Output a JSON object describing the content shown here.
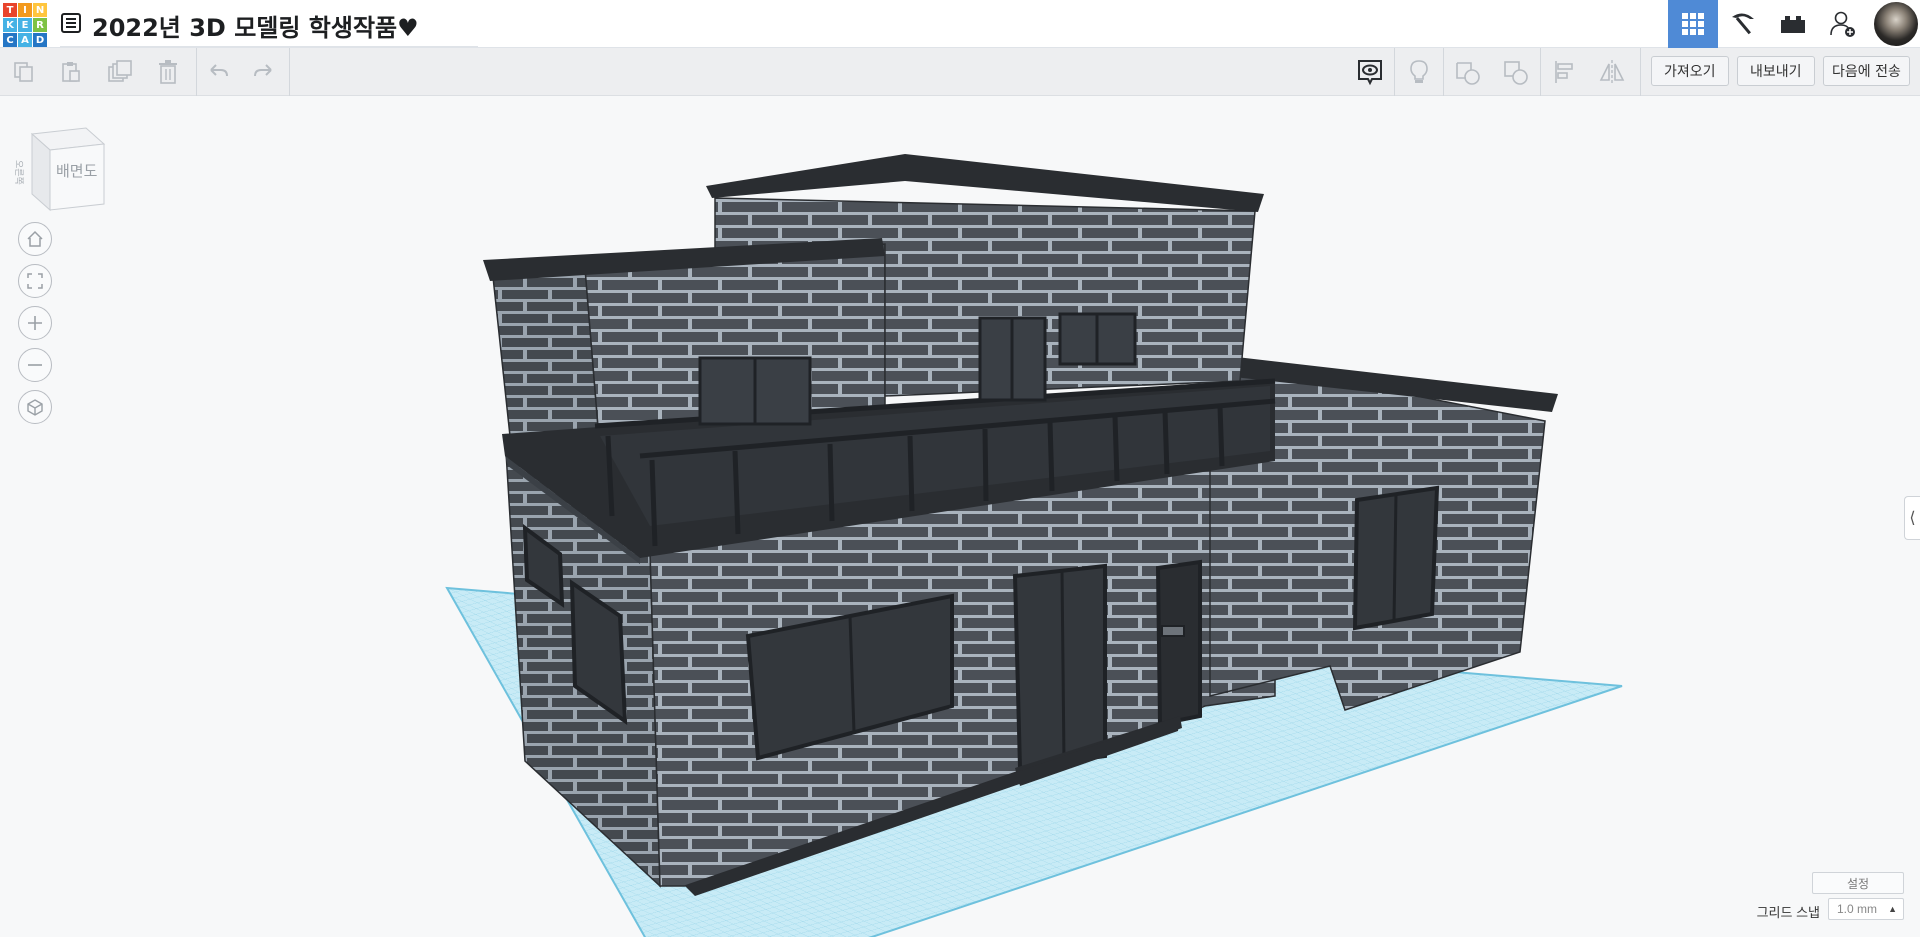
{
  "app": {
    "logo_letters": [
      "T",
      "I",
      "N",
      "K",
      "E",
      "R",
      "C",
      "A",
      "D"
    ],
    "logo_colors": [
      "#e8442c",
      "#f39a1e",
      "#ffc53d",
      "#45b2e5",
      "#45b2e5",
      "#7ec244",
      "#2576c5",
      "#45b2e5",
      "#2576c5"
    ],
    "title": "2022년 3D 모델링 학생작품♥"
  },
  "toolbar": {
    "import_label": "가져오기",
    "export_label": "내보내기",
    "send_to_label": "다음에 전송"
  },
  "viewcube": {
    "face_label": "배면도",
    "side_label": "오른쪽"
  },
  "viewport_panel": {
    "settings_label": "설정",
    "grid_snap_label": "그리드 스냅",
    "grid_snap_value": "1.0 mm"
  },
  "colors": {
    "accent": "#4f8ad6",
    "workplane": "#bfe6f3",
    "model_dark": "#2a2d31",
    "brick": "#4b5057"
  }
}
